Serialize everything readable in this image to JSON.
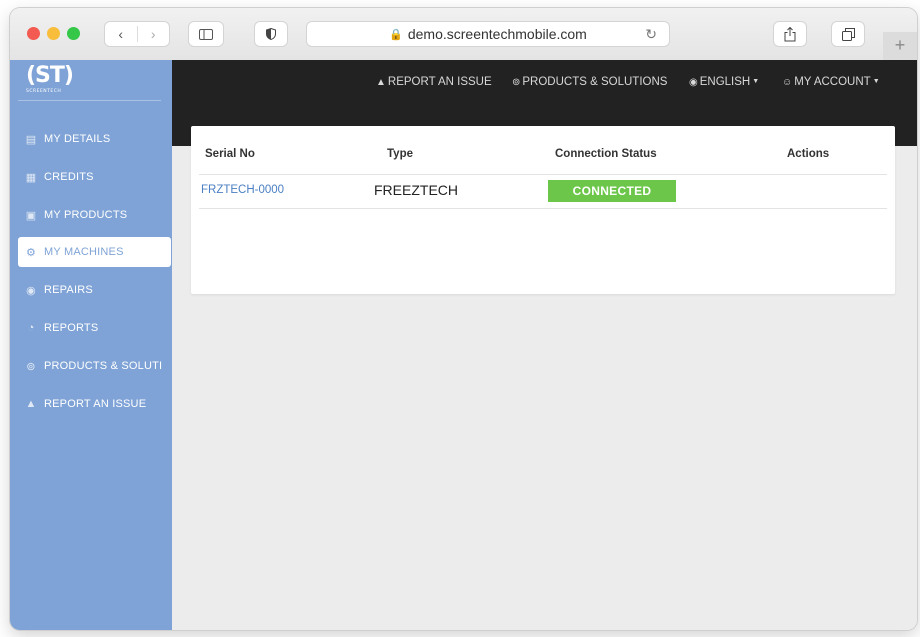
{
  "browser": {
    "url": "demo.screentechmobile.com",
    "icons": [
      "back-icon",
      "forward-icon",
      "sidebar-icon",
      "shield-icon",
      "lock-icon",
      "reload-icon",
      "share-icon",
      "tabs-icon",
      "plus-icon"
    ]
  },
  "logo": {
    "mark": "(ST)",
    "subtitle": "SCREENTECH"
  },
  "sidebar": {
    "items": [
      {
        "label": "MY DETAILS",
        "icon": "id-card-icon"
      },
      {
        "label": "CREDITS",
        "icon": "credits-icon"
      },
      {
        "label": "MY PRODUCTS",
        "icon": "products-icon"
      },
      {
        "label": "MY MACHINES",
        "icon": "machine-icon"
      },
      {
        "label": "REPAIRS",
        "icon": "gear-icon"
      },
      {
        "label": "REPORTS",
        "icon": "chart-icon"
      },
      {
        "label": "PRODUCTS & SOLUTI",
        "icon": "cart-icon"
      },
      {
        "label": "REPORT AN ISSUE",
        "icon": "alert-icon"
      }
    ],
    "active_item": "MY MACHINES"
  },
  "topnav": {
    "report": "REPORT AN ISSUE",
    "products": "PRODUCTS & SOLUTIONS",
    "language": "ENGLISH",
    "account": "MY ACCOUNT"
  },
  "table": {
    "headers": [
      "Serial No",
      "Type",
      "Connection Status",
      "Actions"
    ],
    "rows": [
      {
        "serial": "FRZTECH-0000",
        "type": "FREEZTECH",
        "status": "CONNECTED",
        "actions": ""
      }
    ]
  },
  "colors": {
    "sidebar": "#7fa3d6",
    "topbar": "#222222",
    "status_connected": "#6cc64a",
    "link": "#4b7fc4"
  }
}
